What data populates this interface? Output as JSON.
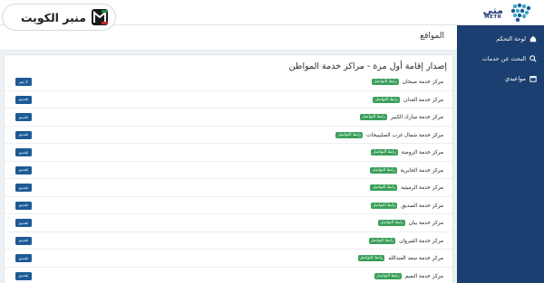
{
  "watermark": {
    "text": "منبر الكويت"
  },
  "brand": {
    "name_ar": "متى",
    "name_en": "METR"
  },
  "sidebar": {
    "items": [
      {
        "label": "لوحة التحكم",
        "icon": "home-icon"
      },
      {
        "label": "البحث عن خدمات",
        "icon": "search-icon"
      },
      {
        "label": "مواعيدي",
        "icon": "calendar-icon"
      }
    ]
  },
  "header": {
    "title": "المواقع"
  },
  "main": {
    "title": "إصدار إقامة أول مرة - مراكز خدمة المواطن",
    "rows": [
      {
        "name": "مركز خدمة صبحان",
        "badge": "رابط التواصل",
        "button": "لا يتم"
      },
      {
        "name": "مركز خدمة العدان",
        "badge": "رابط التواصل",
        "button": "تقديم"
      },
      {
        "name": "مركز خدمة مبارك الكبير",
        "badge": "رابط التواصل",
        "button": "تقديم"
      },
      {
        "name": "مركز خدمة شمال غرب الصليبيخات",
        "badge": "رابط التواصل",
        "button": "تقديم"
      },
      {
        "name": "مركز خدمة الروضة",
        "badge": "رابط التواصل",
        "button": "تقديم"
      },
      {
        "name": "مركز خدمة الجابرية",
        "badge": "رابط التواصل",
        "button": "تقديم"
      },
      {
        "name": "مركز خدمة الرميثية",
        "badge": "رابط التواصل",
        "button": "تقديم"
      },
      {
        "name": "مركز خدمة الصديق",
        "badge": "رابط التواصل",
        "button": "تقديم"
      },
      {
        "name": "مركز خدمة بيان",
        "badge": "رابط التواصل",
        "button": "تقديم"
      },
      {
        "name": "مركز خدمة القيروان",
        "badge": "رابط التواصل",
        "button": "تقديم"
      },
      {
        "name": "مركز خدمة سعد العبدالله",
        "badge": "رابط التواصل",
        "button": "تقديم"
      },
      {
        "name": "مركز خدمة النعيم",
        "badge": "رابط التواصل",
        "button": "تقديم"
      }
    ]
  },
  "colors": {
    "sidebar": "#1b3f70",
    "button": "#1d5a96",
    "badge": "#3aa05a",
    "accent_green": "#1f8a3c",
    "accent_red": "#c62828"
  }
}
